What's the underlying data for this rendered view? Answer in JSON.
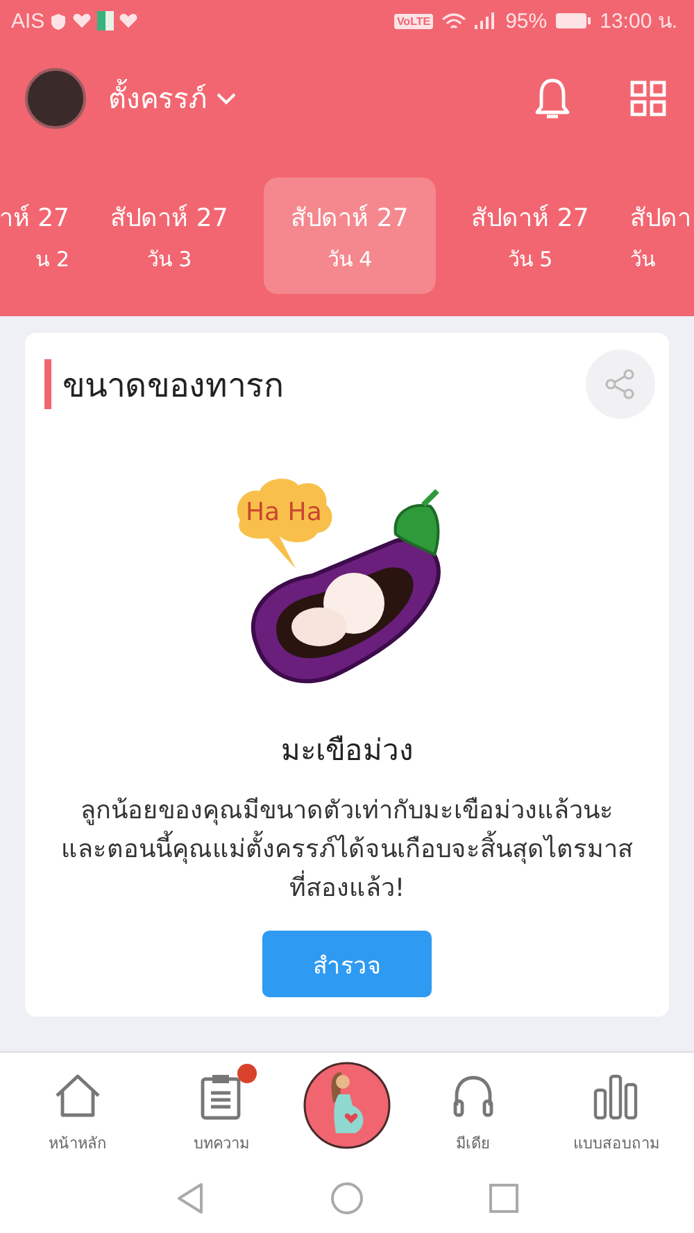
{
  "status_bar": {
    "carrier": "AIS",
    "volte": "VoLTE",
    "battery": "95%",
    "time": "13:00 น."
  },
  "header": {
    "profile_name": "ตั้งครรภ์"
  },
  "day_tabs": [
    {
      "week": "าห์ 27",
      "day": "น 2",
      "selected": false
    },
    {
      "week": "สัปดาห์ 27",
      "day": "วัน 3",
      "selected": false
    },
    {
      "week": "สัปดาห์ 27",
      "day": "วัน 4",
      "selected": true
    },
    {
      "week": "สัปดาห์ 27",
      "day": "วัน 5",
      "selected": false
    },
    {
      "week": "สัปดา",
      "day": "วัน",
      "selected": false
    }
  ],
  "card": {
    "title": "ขนาดของทารก",
    "bubble": "Ha Ha",
    "fruit": "มะเขือม่วง",
    "description": "ลูกน้อยของคุณมีขนาดตัวเท่ากับมะเขือม่วงแล้วนะ และตอนนี้คุณแม่ตั้งครรภ์ได้จนเกือบจะสิ้นสุดไตรมาสที่สองแล้ว!",
    "button": "สำรวจ"
  },
  "bottom_nav": [
    {
      "kind": "home",
      "label": "หน้าหลัก",
      "badge": false
    },
    {
      "kind": "articles",
      "label": "บทความ",
      "badge": true
    },
    {
      "kind": "center"
    },
    {
      "kind": "media",
      "label": "มีเดีย",
      "badge": false
    },
    {
      "kind": "survey",
      "label": "แบบสอบถาม",
      "badge": false
    }
  ]
}
